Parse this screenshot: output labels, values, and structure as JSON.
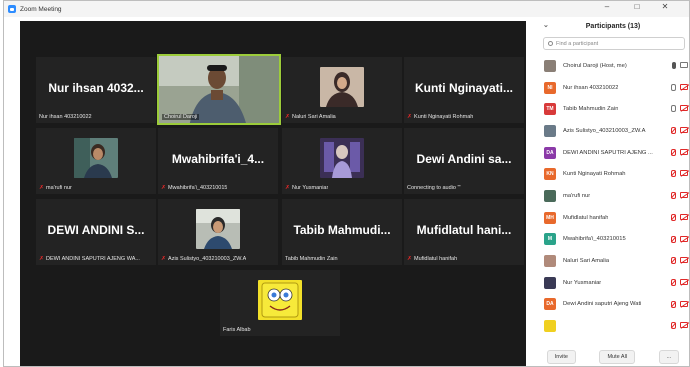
{
  "window": {
    "title": "Zoom Meeting",
    "minimize": "–",
    "maximize": "□",
    "close": "✕"
  },
  "tiles": [
    {
      "type": "name",
      "big": "Nur ihsan 4032...",
      "caption": "Nur ihsan 403210022",
      "muted": false
    },
    {
      "type": "video",
      "caption": "Choirul Daroji",
      "muted": false,
      "active": true
    },
    {
      "type": "video",
      "caption": "Naluri Sari Amalia",
      "muted": true
    },
    {
      "type": "name",
      "big": "Kunti Nginayati...",
      "caption": "Kunti Nginayati Rohmah",
      "muted": true
    },
    {
      "type": "video",
      "caption": "ma'rufi nur",
      "muted": true
    },
    {
      "type": "name",
      "big": "Mwahibrifa'i_4...",
      "caption": "Mwahibrifa'i_403210015",
      "muted": true
    },
    {
      "type": "video",
      "caption": "Nur Yusmaniar",
      "muted": true
    },
    {
      "type": "name",
      "big": "Dewi Andini sa...",
      "caption": "Connecting to audio '''",
      "muted": false
    },
    {
      "type": "name",
      "big": "DEWI ANDINI S...",
      "caption": "DEWI ANDINI SAPUTRI AJENG WA...",
      "muted": true
    },
    {
      "type": "video",
      "caption": "Azis Sulistyo_403210003_ZW.A",
      "muted": true
    },
    {
      "type": "name",
      "big": "Tabib Mahmudi...",
      "caption": "Tabib Mahmudin Zain",
      "muted": false
    },
    {
      "type": "name",
      "big": "Mufidlatul hani...",
      "caption": "Mufidlatul hanifah",
      "muted": true
    },
    {
      "type": "video",
      "caption": "Faris Albab",
      "muted": false
    }
  ],
  "panel": {
    "title": "Participants (13)",
    "collapse": "⌄",
    "search_placeholder": "Find a participant",
    "invite": "Invite",
    "mute_all": "Mute All",
    "more": "...",
    "participants": [
      {
        "name": "Choirul Daroji (Host, me)",
        "initials": "",
        "color": "#8a7f76",
        "mic": "dark",
        "cam": "on"
      },
      {
        "name": "Nur ihsan 403210022",
        "initials": "NI",
        "color": "#e8692c",
        "mic": "on",
        "cam": "off"
      },
      {
        "name": "Tabib Mahmudin Zain",
        "initials": "TM",
        "color": "#d83a3a",
        "mic": "on",
        "cam": "off"
      },
      {
        "name": "Azis Sulistyo_403210003_ZW.A",
        "initials": "",
        "color": "#6a7a88",
        "mic": "muted",
        "cam": "off"
      },
      {
        "name": "DEWI ANDINI SAPUTRI AJENG ...",
        "initials": "DA",
        "color": "#8b3aa8",
        "mic": "muted",
        "cam": "off"
      },
      {
        "name": "Kunti Nginayati Rohmah",
        "initials": "KN",
        "color": "#e8692c",
        "mic": "muted",
        "cam": "off"
      },
      {
        "name": "ma'rufi nur",
        "initials": "",
        "color": "#4a6a5a",
        "mic": "muted",
        "cam": "off"
      },
      {
        "name": "Mufidlatul hanifah",
        "initials": "MH",
        "color": "#e8692c",
        "mic": "muted",
        "cam": "off"
      },
      {
        "name": "Mwahibrifa'i_403210015",
        "initials": "M",
        "color": "#2aa38a",
        "mic": "muted",
        "cam": "off"
      },
      {
        "name": "Naluri Sari Amalia",
        "initials": "",
        "color": "#b08a7a",
        "mic": "muted",
        "cam": "off"
      },
      {
        "name": "Nur Yusmaniar",
        "initials": "",
        "color": "#3a3a55",
        "mic": "muted",
        "cam": "off"
      },
      {
        "name": "Dewi Andini saputri Ajeng Wati",
        "initials": "DA",
        "color": "#e8692c",
        "mic": "muted",
        "cam": "off"
      },
      {
        "name": "",
        "initials": "",
        "color": "#f0d020",
        "mic": "muted",
        "cam": "off"
      }
    ]
  }
}
